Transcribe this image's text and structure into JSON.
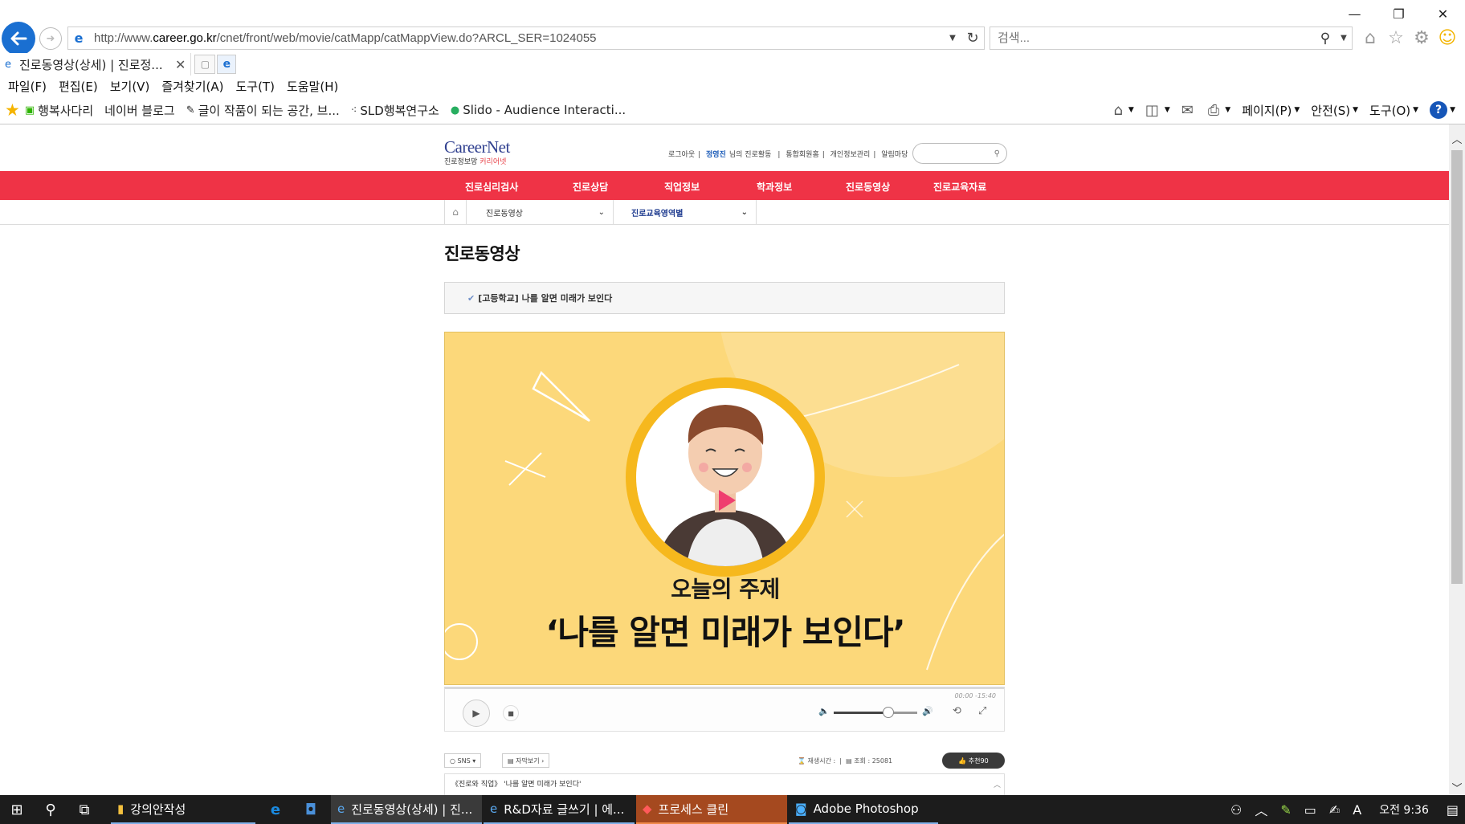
{
  "browser": {
    "url_prefix": "http://www.",
    "url_domain": "career.go.kr",
    "url_path": "/cnet/front/web/movie/catMapp/catMappView.do?ARCL_SER=1024055",
    "search_placeholder": "검색...",
    "tab_title": "진로동영상(상세) | 진로정...",
    "menu": [
      "파일(F)",
      "편집(E)",
      "보기(V)",
      "즐겨찾기(A)",
      "도구(T)",
      "도움말(H)"
    ],
    "favorites": [
      {
        "label": "행복사다리"
      },
      {
        "label": "네이버 블로그"
      },
      {
        "label": "글이 작품이 되는 공간, 브..."
      },
      {
        "label": "SLD행복연구소"
      },
      {
        "label": "Slido - Audience Interacti..."
      }
    ],
    "commands": {
      "page": "페이지(P)",
      "safety": "안전(S)",
      "tools": "도구(O)",
      "help": "?"
    }
  },
  "site": {
    "logo_main": "CareerNet",
    "logo_sub": "진로정보망",
    "logo_sub_brand": "커리어넷",
    "util_nav": [
      "로그아웃",
      "정영진님의 진로활동",
      "통합회원홈",
      "개인정보관리",
      "알림마당"
    ],
    "util_highlight": "정영진",
    "main_nav": [
      "진로심리검사",
      "진로상담",
      "직업정보",
      "학과정보",
      "진로동영상",
      "진로교육자료"
    ],
    "breadcrumb": {
      "level1": "진로동영상",
      "level2": "진로교육영역별"
    },
    "page_title": "진로동영상",
    "video_title": "[고등학교] 나를 알면 미래가 보인다",
    "video_caption_small": "오늘의 주제",
    "video_caption_large": "‘나를 알면 미래가 보인다’",
    "player": {
      "time": "00:00 -15:40",
      "volume_fraction": 0.65
    },
    "below": {
      "sns_label": "SNS",
      "subtitle_label": "자막보기",
      "runtime_label": "재생시간 :",
      "views_label": "조회 : 25081",
      "recommend_label": "추천90"
    },
    "description": "《진로와 직업》 '나를 알면 미래가 보인다'"
  },
  "taskbar": {
    "apps": [
      {
        "label": "강의안작성"
      },
      {
        "label": "진로동영상(상세) | 진..."
      },
      {
        "label": "R&D자료 글쓰기 | 에..."
      },
      {
        "label": "프로세스 클린"
      },
      {
        "label": "Adobe Photoshop"
      }
    ],
    "clock": "오전 9:36"
  },
  "colors": {
    "brand_red": "#ef3346",
    "ie_blue": "#1a6fd1",
    "video_bg": "#fcd87a"
  }
}
